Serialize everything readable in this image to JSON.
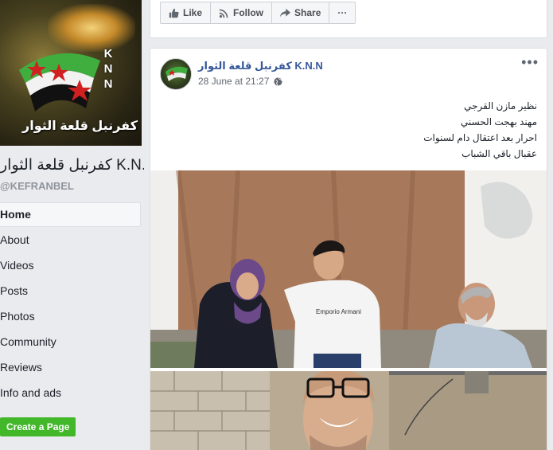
{
  "page": {
    "cover_text": "كفرنبل قلعة الثوار",
    "cover_letters": [
      "K",
      "N",
      "N"
    ],
    "name": "كفرنبل قلعة الثوار K.N.N",
    "handle": "@KEFRANBEL"
  },
  "nav": {
    "items": [
      "Home",
      "About",
      "Videos",
      "Posts",
      "Photos",
      "Community",
      "Reviews",
      "Info and ads"
    ],
    "active": "Home",
    "create_page": "Create a Page"
  },
  "actions": {
    "like": "Like",
    "follow": "Follow",
    "share": "Share",
    "more": "···"
  },
  "post": {
    "author": "كفرنبل قلعة الثوار K.N.N",
    "date": "28 June at 21:27",
    "privacy_icon": "globe-icon",
    "more": "•••",
    "lines": [
      "نظير مازن القرجي",
      "مهند بهجت الحسني",
      "احرار بعد اعتقال دام لسنوات",
      "عقبال باقي الشباب"
    ],
    "shirt_text": "Emporio Armani"
  },
  "colors": {
    "link": "#365899",
    "create_button": "#42b72a",
    "background": "#e9ebee"
  }
}
